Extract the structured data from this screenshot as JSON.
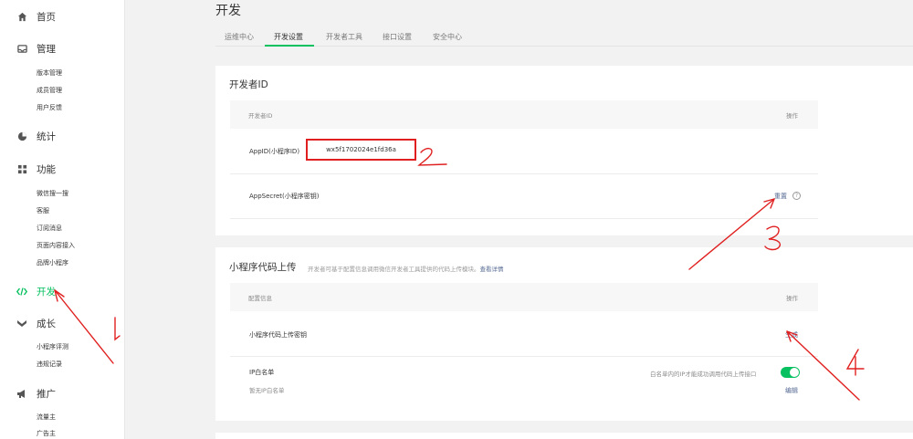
{
  "sidebar": {
    "home": "首页",
    "manage": "管理",
    "manage_items": [
      "版本管理",
      "成员管理",
      "用户反馈"
    ],
    "stats": "统计",
    "features": "功能",
    "feature_items": [
      "微信搜一搜",
      "客服",
      "订阅消息",
      "页面内容接入",
      "品牌小程序"
    ],
    "develop": "开发",
    "growth": "成长",
    "growth_items": [
      "小程序评测",
      "违规记录"
    ],
    "promote": "推广",
    "promote_items": [
      "流量主",
      "广告主"
    ]
  },
  "page": {
    "title": "开发",
    "tabs": [
      "运维中心",
      "开发设置",
      "开发者工具",
      "接口设置",
      "安全中心"
    ],
    "active_tab": "开发设置"
  },
  "dev_id": {
    "title": "开发者ID",
    "col_left": "开发者ID",
    "col_right": "操作",
    "appid_label": "AppID(小程序ID)",
    "appid_value": "wx5f1702024e1fd36a",
    "secret_label": "AppSecret(小程序密钥)",
    "secret_action": "重置",
    "help_glyph": "?"
  },
  "upload": {
    "title": "小程序代码上传",
    "desc": "开发者可基于配置信息调用微信开发者工具提供的代码上传模块。",
    "desc_link": "查看详情",
    "col_left": "配置信息",
    "col_right": "操作",
    "key_label": "小程序代码上传密钥",
    "key_action": "生成",
    "ip_label": "IP白名单",
    "ip_hint": "白名单内的IP才能成功调用代码上传接口",
    "ip_empty": "暂无IP白名单",
    "ip_action": "编辑",
    "ip_toggle_on": true
  },
  "annotations": [
    "1",
    "2",
    "3",
    "4"
  ],
  "colors": {
    "accent": "#07c160",
    "link": "#576b95",
    "annotation": "#e02020"
  }
}
